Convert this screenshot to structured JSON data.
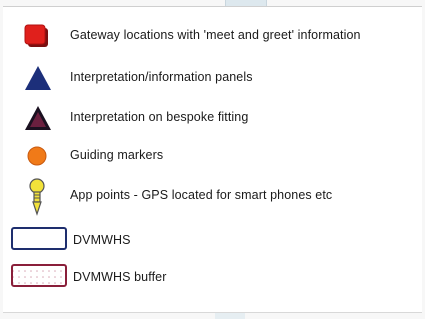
{
  "legend": {
    "items": [
      {
        "symbol": "red-square",
        "label": "Gateway locations with 'meet and greet' information"
      },
      {
        "symbol": "blue-triangle",
        "label": "Interpretation/information panels"
      },
      {
        "symbol": "maroon-triangle",
        "label": "Interpretation on bespoke fitting"
      },
      {
        "symbol": "orange-circle",
        "label": "Guiding markers"
      },
      {
        "symbol": "yellow-pin",
        "label": "App points - GPS located for smart phones etc"
      },
      {
        "symbol": "blue-outline-rectangle",
        "label": "DVMWHS"
      },
      {
        "symbol": "dotted-red-rectangle",
        "label": "DVMWHS buffer"
      }
    ]
  },
  "colors": {
    "gateway_red": "#e0201c",
    "panel_blue": "#1c2f7a",
    "bespoke_maroon": "#6a1f3f",
    "guiding_orange": "#f07a18",
    "pin_yellow": "#f2e23a",
    "dvmwhs_outline": "#1e2e6e",
    "buffer_outline": "#8a1f3a"
  }
}
